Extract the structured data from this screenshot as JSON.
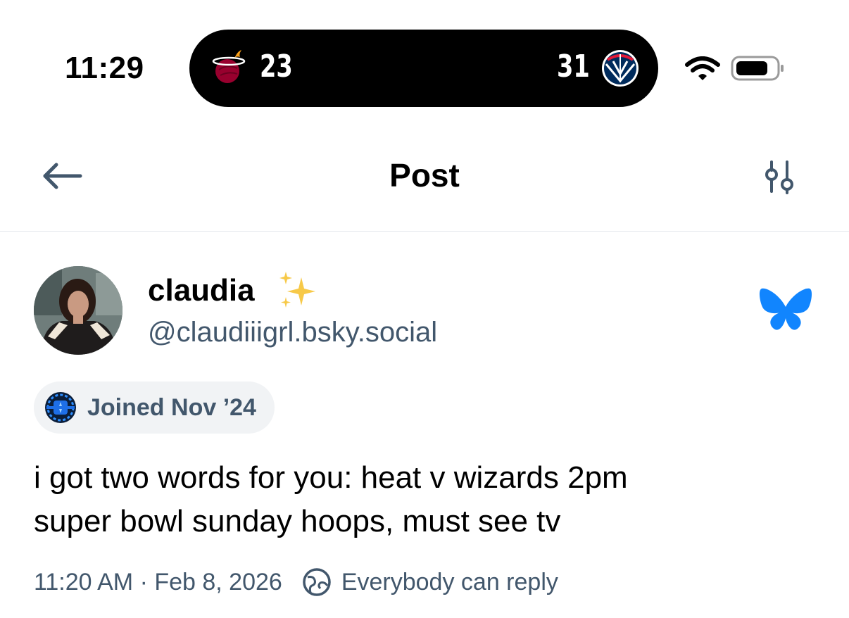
{
  "status_bar": {
    "time": "11:29",
    "live_activity": {
      "home_team_icon": "miami-heat-logo",
      "home_score": "23",
      "away_score": "31",
      "away_team_icon": "washington-wizards-logo"
    },
    "wifi_icon": "wifi-icon",
    "battery_icon": "battery-icon"
  },
  "header": {
    "back_icon": "arrow-left-icon",
    "title": "Post",
    "filter_icon": "sliders-icon"
  },
  "post": {
    "author": {
      "display_name": "claudia",
      "emoji": "✨",
      "handle": "@claudiiigrl.bsky.social",
      "avatar_icon": "avatar"
    },
    "platform_icon": "bluesky-butterfly-icon",
    "joined_badge": "Joined Nov ’24",
    "text_line1": "i got two words for you: heat v wizards 2pm",
    "text_line2": "super bowl sunday hoops, must see tv",
    "timestamp": "11:20 AM · Feb 8, 2026",
    "reply_setting": "Everybody can reply"
  },
  "colors": {
    "accent_blue": "#1185fe",
    "muted_text": "#42576c",
    "divider": "#e5e8ec",
    "badge_bg": "#f1f3f5"
  }
}
